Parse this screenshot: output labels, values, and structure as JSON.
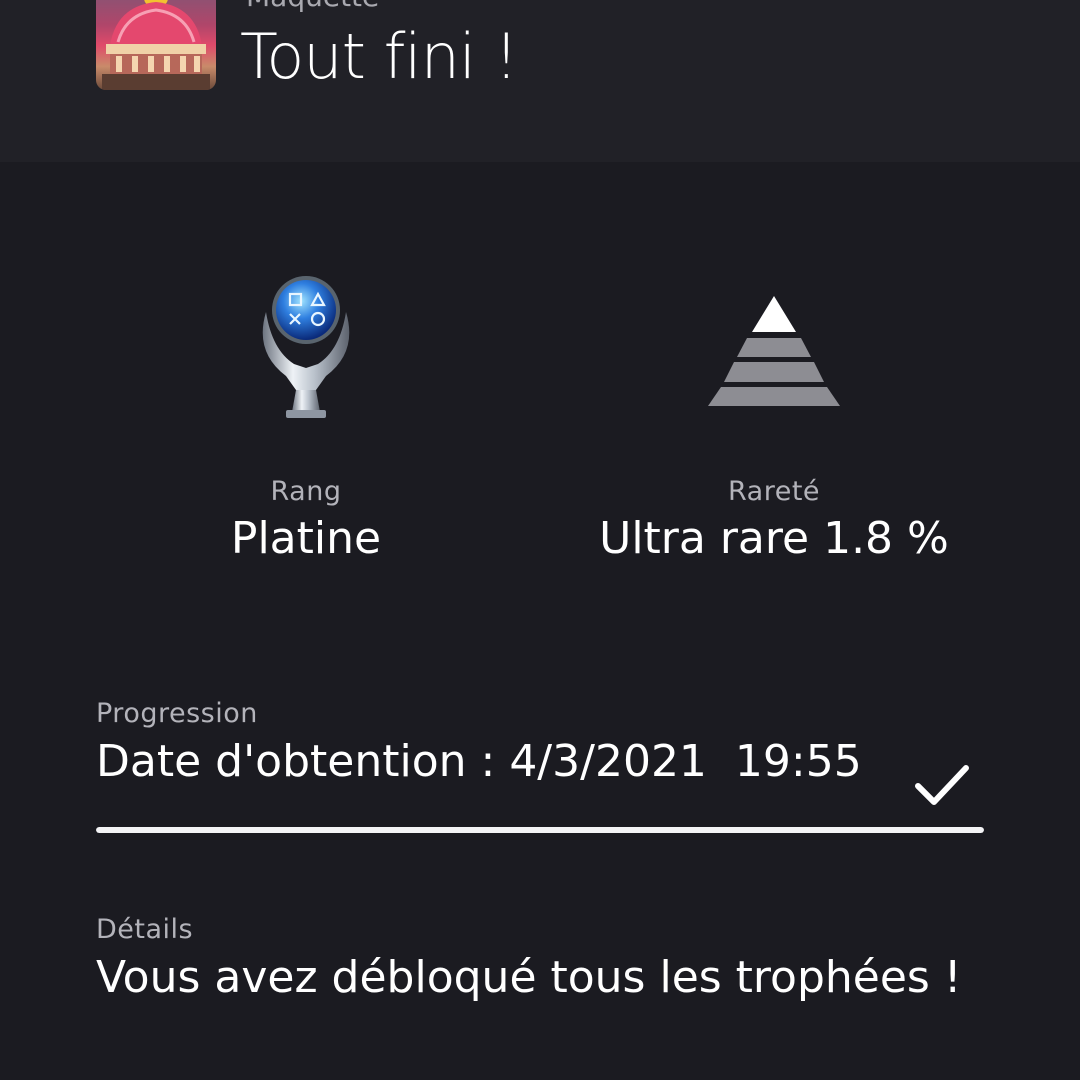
{
  "header": {
    "game_name": "Maquette",
    "trophy_title": "Tout fini !"
  },
  "icons": {
    "game_thumbnail": "game-thumbnail",
    "grade": "platinum-trophy-icon",
    "rarity": "ultra-rare-pyramid-icon",
    "earned": "checkmark-icon"
  },
  "stats": {
    "grade_label": "Rang",
    "grade_value": "Platine",
    "rarity_label": "Rareté",
    "rarity_value": "Ultra rare 1.8 %"
  },
  "progress": {
    "label": "Progression",
    "value": "Date d'obtention : 4/3/2021  19:55",
    "percent": 100
  },
  "details": {
    "label": "Détails",
    "value": "Vous avez débloqué tous les trophées !"
  },
  "colors": {
    "background": "#1b1b21",
    "header_background": "#212127",
    "progress_fill": "#f4f4f6"
  }
}
